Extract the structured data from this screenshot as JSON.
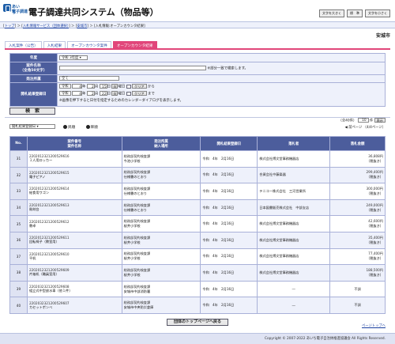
{
  "header": {
    "logo_line1": "あいち",
    "logo_line2": "電子調達",
    "title": "電子調達共同システム（物品等）",
    "buttons": [
      "文字を大きく",
      "標　準",
      "文字を小さく"
    ]
  },
  "breadcrumb": {
    "items": [
      "トップ",
      "入札情報サービス（団体選択）",
      "安城市",
      "入札情報:オープンカウンタ結果"
    ],
    "sep": "＞"
  },
  "city": "安城市",
  "tabs": [
    "入札案件（公告）",
    "入札結果",
    "オープンカウンタ案件",
    "オープンカウンタ結果"
  ],
  "form": {
    "year_label": "年度",
    "year_value": "令和 3年度",
    "case_label": "案件名称\n（全角50文字）",
    "case_note": "※部分一致で検索します。",
    "dept_label": "発注所属",
    "dept_value": "全て",
    "date_label": "開札結果登録日",
    "from": {
      "era": "令和",
      "y": "4",
      "m": "2",
      "d": "15",
      "dow": "火",
      "unit_y": "年",
      "unit_m": "月",
      "unit_d": "日",
      "yobi": "曜日",
      "clear": "クリア",
      "suffix": "から"
    },
    "to": {
      "era": "令和",
      "y": "4",
      "m": "2",
      "d": "22",
      "dow": "火",
      "unit_y": "年",
      "unit_m": "月",
      "unit_d": "日",
      "yobi": "曜日",
      "clear": "クリア",
      "suffix": "まで"
    },
    "cal_note": "※画像を押下すると日付を指定するためのカレンダーダイアログを表示します。",
    "search_button": "検　索"
  },
  "sort": {
    "select": "開札結果登録日",
    "asc": "昇順",
    "desc": "降順"
  },
  "pager": {
    "total": "（全40件）",
    "per_page": "10",
    "per_unit": "件",
    "display": "表示",
    "prev": "前ページ",
    "pages": "（4/4ページ）"
  },
  "table": {
    "headers": [
      "No.",
      "案件番号\n案件名称",
      "発注所属\n納入場所",
      "開札結果登録日",
      "落札者",
      "落札金額"
    ],
    "rows": [
      {
        "no": "31",
        "num": "2202012321200529616",
        "name": "１人用ロッカー",
        "dept": "総務部契約検査課",
        "place": "今池小学校",
        "date": "令和　4年　2月16日",
        "winner": "株式会社博文堂事務機器店",
        "amount": "36,808円",
        "tax": "（税抜き）"
      },
      {
        "no": "32",
        "num": "2202012321200529615",
        "name": "電子ピアノ",
        "dept": "総務部契約検査課",
        "place": "仕様書のとおり",
        "date": "令和　4年　2月16日",
        "winner": "合資会社中藤楽器",
        "amount": "299,400円",
        "tax": "（税抜き）"
      },
      {
        "no": "33",
        "num": "2202012321200529614",
        "name": "給食用ワゴン",
        "dept": "総務部契約検査課",
        "place": "仕様書のとおり",
        "date": "令和　4年　2月16日",
        "winner": "テニコー株式会社　三河営業所",
        "amount": "300,000円",
        "tax": "（税抜き）"
      },
      {
        "no": "34",
        "num": "2202012321200529613",
        "name": "彫刻台",
        "dept": "総務部契約検査課",
        "place": "仕様書のとおり",
        "date": "令和　4年　2月16日",
        "winner": "日本図書販売株式会社　中部支店",
        "amount": "249,000円",
        "tax": "（税抜き）"
      },
      {
        "no": "35",
        "num": "2202012321200529612",
        "name": "教卓",
        "dept": "総務部契約検査課",
        "place": "桜井小学校",
        "date": "令和　4年　2月16日",
        "winner": "株式会社博文堂事務機器店",
        "amount": "42,600円",
        "tax": "（税抜き）"
      },
      {
        "no": "36",
        "num": "2202012321200529611",
        "name": "回転椅子（教室用）",
        "dept": "総務部契約検査課",
        "place": "桜井小学校",
        "date": "令和　4年　2月16日",
        "winner": "株式会社博文堂事務機器店",
        "amount": "35,400円",
        "tax": "（税抜き）"
      },
      {
        "no": "37",
        "num": "2202012321200529610",
        "name": "平机",
        "dept": "総務部契約検査課",
        "place": "桜井小学校",
        "date": "令和　4年　2月16日",
        "winner": "株式会社博文堂事務機器店",
        "amount": "77,400円",
        "tax": "（税抜き）"
      },
      {
        "no": "38",
        "num": "2202012321200529609",
        "name": "片袖机（職員室用）",
        "dept": "総務部契約検査課",
        "place": "桜井小学校",
        "date": "令和　4年　2月16日",
        "winner": "株式会社博文堂事務機器店",
        "amount": "188,500円",
        "tax": "（税抜き）"
      },
      {
        "no": "39",
        "num": "2202032321200529608",
        "name": "組立式中型放水車（他１件）",
        "dept": "総務部契約検査課",
        "place": "安城市中部消防署",
        "date": "令和　4年　2月16日",
        "winner": "―",
        "amount": "不調",
        "tax": ""
      },
      {
        "no": "40",
        "num": "2202032321200529607",
        "name": "カセットボンベ",
        "dept": "総務部契約検査課",
        "place": "安城市中央防災倉庫",
        "date": "令和　4年　2月16日",
        "winner": "―",
        "amount": "不調",
        "tax": ""
      }
    ]
  },
  "top_button": "団体のトップページへ戻る",
  "page_top": "ページトップへ",
  "copyright": "Copyright © 2007-2022 あいち電子自治体推進協議会 All Rights Reserved."
}
